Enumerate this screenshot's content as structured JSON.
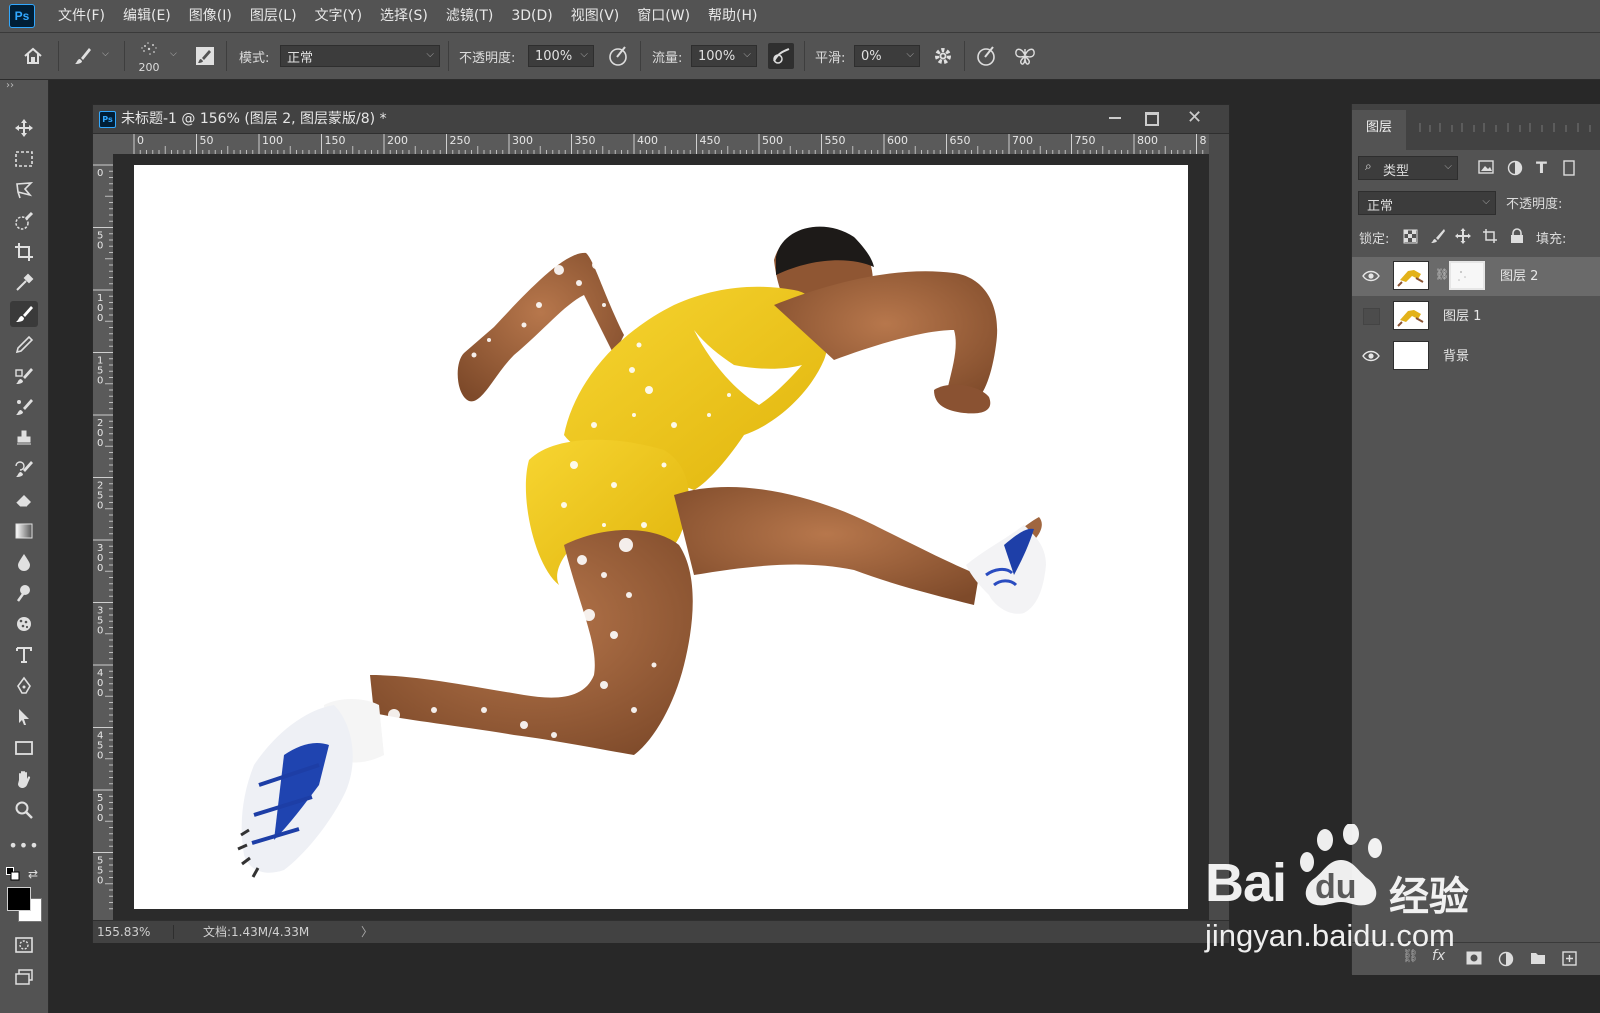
{
  "app": {
    "logo": "Ps"
  },
  "menu": [
    "文件(F)",
    "编辑(E)",
    "图像(I)",
    "图层(L)",
    "文字(Y)",
    "选择(S)",
    "滤镜(T)",
    "3D(D)",
    "视图(V)",
    "窗口(W)",
    "帮助(H)"
  ],
  "options": {
    "brush_size": "200",
    "mode_label": "模式:",
    "mode_value": "正常",
    "opacity_label": "不透明度:",
    "opacity_value": "100%",
    "flow_label": "流量:",
    "flow_value": "100%",
    "smooth_label": "平滑:",
    "smooth_value": "0%"
  },
  "document": {
    "title": "未标题-1 @ 156% (图层 2, 图层蒙版/8) *",
    "ruler_h": [
      "0",
      "50",
      "100",
      "150",
      "200",
      "250",
      "300",
      "350",
      "400",
      "450",
      "500",
      "550",
      "600",
      "650",
      "700",
      "750",
      "800",
      "8"
    ],
    "ruler_v": [
      "0",
      "5\n0",
      "1\n0\n0",
      "1\n5\n0",
      "2\n0\n0",
      "2\n5\n0",
      "3\n0\n0",
      "3\n5\n0",
      "4\n0\n0",
      "4\n5\n0",
      "5\n0\n0",
      "5\n5\n0"
    ],
    "zoom": "155.83%",
    "doc_info": "文档:1.43M/4.33M"
  },
  "layers_panel": {
    "tab": "图层",
    "filter_kind": "类型",
    "blend_mode": "正常",
    "opacity_label": "不透明度:",
    "lock_label": "锁定:",
    "fill_label": "填充:",
    "layers": [
      {
        "name": "图层 2",
        "visible": true,
        "selected": true,
        "has_mask": true
      },
      {
        "name": "图层 1",
        "visible": false,
        "selected": false,
        "has_mask": false
      },
      {
        "name": "背景",
        "visible": true,
        "selected": false,
        "has_mask": false
      }
    ]
  },
  "watermark": {
    "brand": "Bai",
    "brand2": "du",
    "suffix": "经验",
    "url": "jingyan.baidu.com"
  },
  "colors": {
    "accent": "#31a8ff",
    "ui_bg": "#535353",
    "workspace": "#282828",
    "shirt": "#f2c818",
    "skin": "#a0663f"
  }
}
